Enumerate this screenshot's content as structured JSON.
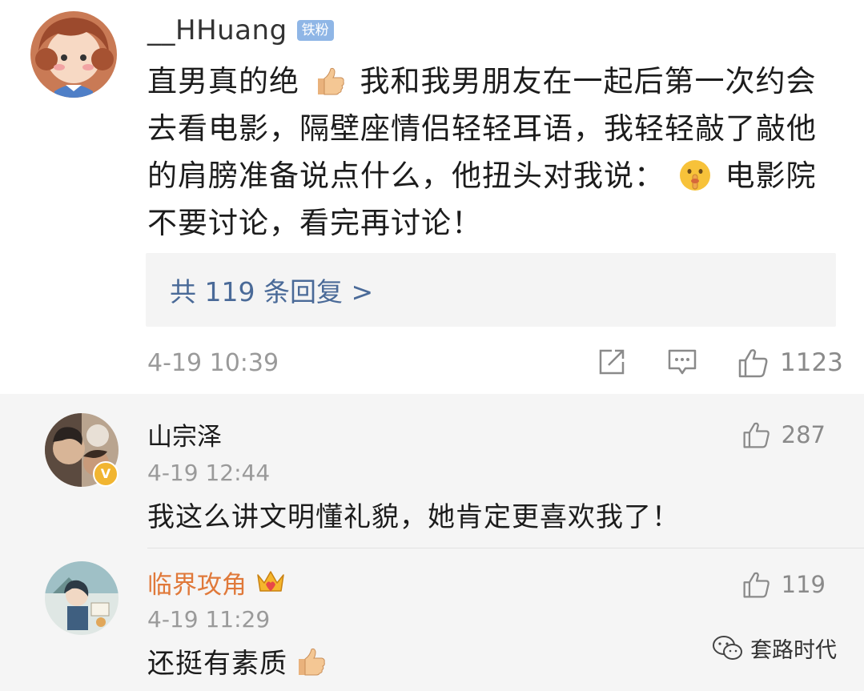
{
  "main_comment": {
    "username": "__HHuang",
    "fan_badge": "铁粉",
    "text_part1": "直男真的绝",
    "text_part2": "我和我男朋友在一起后第一次约会去看电影，隔壁座情侣轻轻耳语，我轻轻敲了敲他的肩膀准备说点什么，他扭头对我说：",
    "text_part3": "电影院不要讨论，看完再讨论！",
    "emoji1": "thumbs-up-icon",
    "emoji2": "shushing-face-icon",
    "reply_link": "共 119 条回复 >",
    "timestamp": "4-19 10:39",
    "like_count": "1123"
  },
  "replies": [
    {
      "name": "山宗泽",
      "time": "4-19 12:44",
      "text": "我这么讲文明懂礼貌，她肯定更喜欢我了！",
      "likes": "287",
      "name_color": "#333333",
      "badge": "V"
    },
    {
      "name": "临界攻角",
      "time": "4-19 11:29",
      "text": "还挺有素质",
      "likes": "119",
      "name_color": "#e0793a",
      "badge": "crown-icon"
    }
  ],
  "watermark": "套路时代",
  "colors": {
    "link": "#4a6a98",
    "fan_badge": "#8fb6e6",
    "orange_name": "#e0793a"
  }
}
